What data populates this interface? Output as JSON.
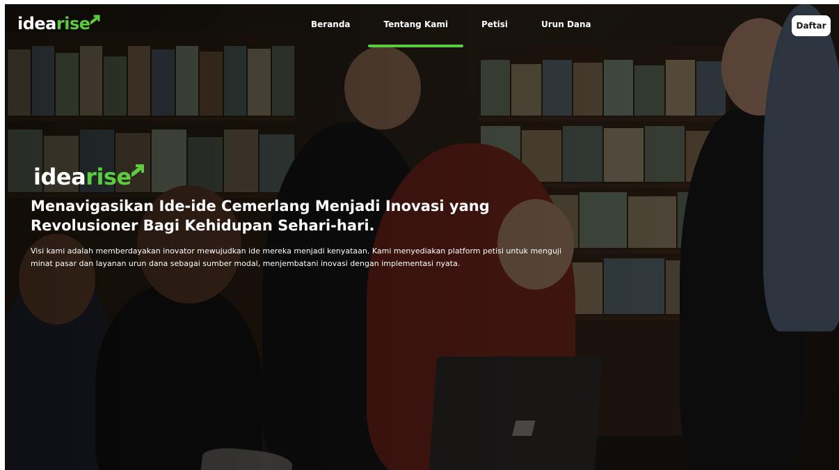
{
  "nav": {
    "logo": {
      "prefix": "idea",
      "accent": "rise"
    },
    "items": [
      {
        "label": "Beranda"
      },
      {
        "label": "Tentang Kami",
        "active": true
      },
      {
        "label": "Petisi"
      },
      {
        "label": "Urun Dana"
      }
    ],
    "register_label": "Daftar"
  },
  "hero": {
    "logo": {
      "prefix": "idea",
      "accent": "rise"
    },
    "title": "Menavigasikan Ide-ide Cemerlang Menjadi Inovasi yang Revolusioner Bagi Kehidupan Sehari-hari.",
    "description": "Visi kami adalah memberdayakan inovator mewujudkan ide mereka menjadi kenyataan. Kami menyediakan platform petisi untuk menguji minat pasar dan layanan urun dana sebagai sumber modal, menjembatani inovasi dengan implementasi nyata."
  },
  "colors": {
    "accent": "#5ccb3f",
    "text": "#ffffff",
    "button_bg": "#ffffff"
  },
  "icons": [
    "logo-arrow-icon"
  ]
}
